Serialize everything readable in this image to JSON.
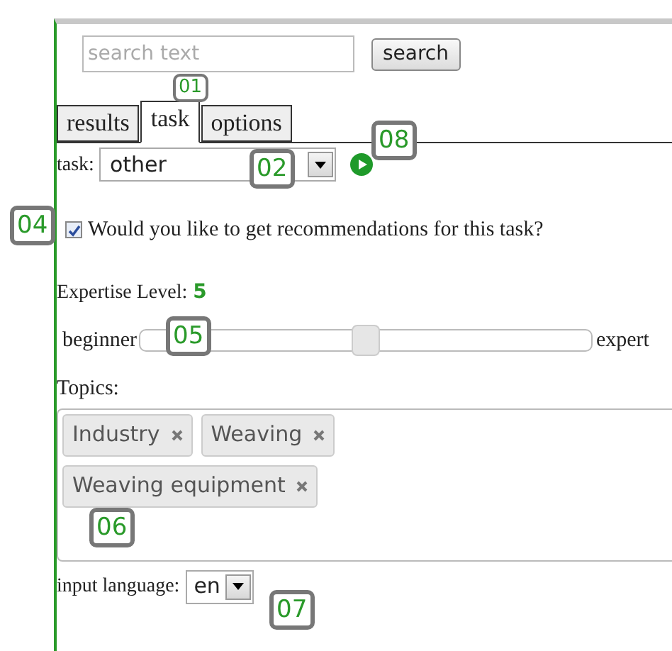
{
  "search": {
    "placeholder": "search text",
    "button": "search"
  },
  "tabs": [
    {
      "label": "results",
      "selected": false
    },
    {
      "label": "task",
      "selected": true
    },
    {
      "label": "options",
      "selected": false
    }
  ],
  "task": {
    "label": "task:",
    "value": "other"
  },
  "recommendations": {
    "label": "Would you like to get recommendations for this task?",
    "checked": true
  },
  "expertise": {
    "label": "Expertise Level:",
    "value": "5",
    "min_label": "beginner",
    "max_label": "expert",
    "level": 0.5
  },
  "topics": {
    "label": "Topics:",
    "tags": [
      "Industry",
      "Weaving",
      "Weaving equipment"
    ]
  },
  "input_language": {
    "label": "input language:",
    "value": "en"
  },
  "callouts": [
    {
      "label": "01"
    },
    {
      "label": "08"
    },
    {
      "label": "02"
    },
    {
      "label": "04"
    },
    {
      "label": "05"
    },
    {
      "label": "06"
    },
    {
      "label": "07"
    }
  ]
}
